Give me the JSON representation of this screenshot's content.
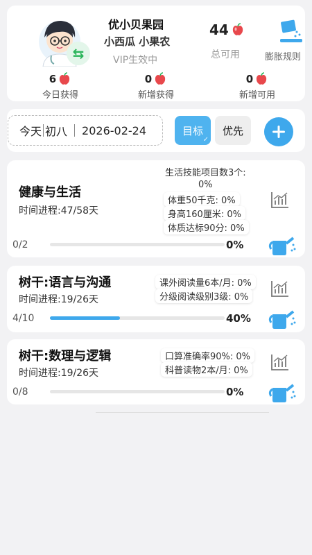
{
  "header": {
    "app_name": "优小贝果园",
    "user_names": "小西瓜 小果农",
    "vip_status": "VIP生效中",
    "total_count": "44",
    "total_label": "总可用",
    "expand_rules_label": "膨胀规则",
    "stats": [
      {
        "num": "6",
        "label": "今日获得"
      },
      {
        "num": "0",
        "label": "新增获得"
      },
      {
        "num": "0",
        "label": "新增可用"
      }
    ]
  },
  "date_row": {
    "today": "今天",
    "lunar": "初八",
    "date": "2026-02-24",
    "goal_label": "目标",
    "priority_label": "优先"
  },
  "goals": [
    {
      "title": "健康与生活",
      "time_progress": "时间进程:47/58天",
      "metrics": [
        "生活技能项目数3个:",
        "0%",
        "体重50千克: 0%",
        "身高160厘米: 0%",
        "体质达标90分: 0%"
      ],
      "count": "0/2",
      "percent": "0%",
      "progress": 0
    },
    {
      "title": "树干:语言与沟通",
      "time_progress": "时间进程:19/26天",
      "metrics": [
        "课外阅读量6本/月: 0%",
        "分级阅读级别3级: 0%"
      ],
      "count": "4/10",
      "percent": "40%",
      "progress": 0.4
    },
    {
      "title": "树干:数理与逻辑",
      "time_progress": "时间进程:19/26天",
      "metrics": [
        "口算准确率90%: 0%",
        "科普读物2本/月: 0%"
      ],
      "count": "0/8",
      "percent": "0%",
      "progress": 0
    }
  ],
  "colors": {
    "accent": "#3ea8ec",
    "apple": "#e8484c",
    "green": "#2bb55b"
  }
}
